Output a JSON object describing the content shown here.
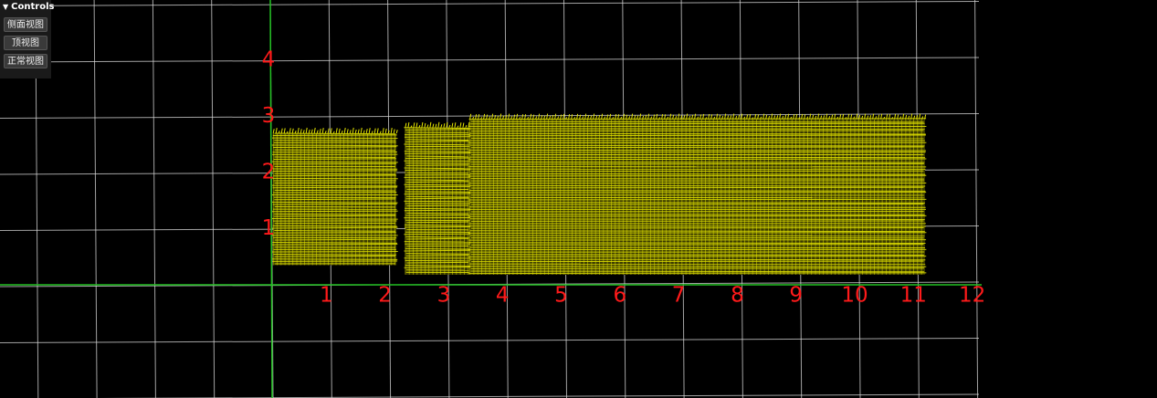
{
  "controls": {
    "title": "Controls",
    "buttons": [
      {
        "label": "侧面视图"
      },
      {
        "label": "顶视图"
      },
      {
        "label": "正常视图"
      }
    ]
  },
  "axes": {
    "x_labels": [
      "1",
      "2",
      "3",
      "4",
      "5",
      "6",
      "7",
      "8",
      "9",
      "10",
      "11",
      "12"
    ],
    "y_labels": [
      "1",
      "2",
      "3",
      "4"
    ],
    "label_color": "#ff1a1a",
    "axis_color": "#22c022",
    "grid_color": "#d8d8d8"
  },
  "point_cloud": {
    "color": "#e6e600",
    "x_range": [
      0,
      11.1
    ],
    "y_range": [
      0.2,
      2.8
    ]
  }
}
